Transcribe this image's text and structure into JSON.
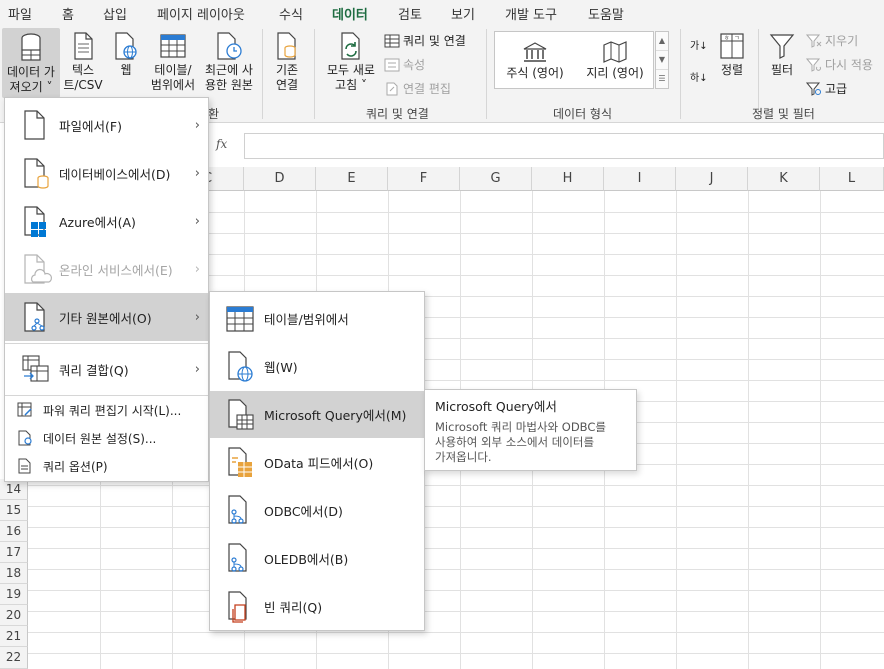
{
  "tabs": [
    "파일",
    "홈",
    "삽입",
    "페이지 레이아웃",
    "수식",
    "데이터",
    "검토",
    "보기",
    "개발 도구",
    "도움말"
  ],
  "active_tab": "데이터",
  "ribbon": {
    "get_data": {
      "line1": "데이터 가",
      "line2": "져오기 ˅"
    },
    "text_csv": {
      "line1": "텍스",
      "line2": "트/CSV"
    },
    "web": {
      "line1": "웹"
    },
    "table_range": {
      "line1": "테이블/",
      "line2": "범위에서"
    },
    "recent_sources": {
      "line1": "최근에 사",
      "line2": "용한 원본"
    },
    "existing_conn": {
      "line1": "기존",
      "line2": "연결"
    },
    "group_get_partial": "환",
    "refresh_all": {
      "line1": "모두 새로",
      "line2": "고침 ˅"
    },
    "queries_conn": "쿼리 및 연결",
    "properties": "속성",
    "edit_links": "연결 편집",
    "group_queries": "쿼리 및 연결",
    "stocks": "주식 (영어)",
    "geography": "지리 (영어)",
    "group_data_types": "데이터 형식",
    "sort_az": "가↓",
    "sort_za": "하↓",
    "sort": "정렬",
    "filter": "필터",
    "clear": "지우기",
    "reapply": "다시 적용",
    "advanced": "고급",
    "group_sort_filter": "정렬 및 필터"
  },
  "formula_bar": {
    "fx": "fx"
  },
  "columns": [
    "C",
    "D",
    "E",
    "F",
    "G",
    "H",
    "I",
    "J",
    "K",
    "L"
  ],
  "rows": [
    "14",
    "15",
    "16",
    "17",
    "18",
    "19",
    "20",
    "21",
    "22"
  ],
  "main_menu": {
    "items": [
      {
        "label": "파일에서(F)",
        "arrow": "›"
      },
      {
        "label": "데이터베이스에서(D)",
        "arrow": "›"
      },
      {
        "label": "Azure에서(A)",
        "arrow": "›"
      },
      {
        "label": "온라인 서비스에서(E)",
        "arrow": "›"
      },
      {
        "label": "기타 원본에서(O)",
        "arrow": "›"
      },
      {
        "label": "쿼리 결합(Q)",
        "arrow": "›"
      }
    ],
    "small_items": [
      {
        "label": "파워 쿼리 편집기 시작(L)..."
      },
      {
        "label": "데이터 원본 설정(S)..."
      },
      {
        "label": "쿼리 옵션(P)"
      }
    ]
  },
  "sub_menu": {
    "items": [
      {
        "label": "테이블/범위에서"
      },
      {
        "label": "웹(W)"
      },
      {
        "label": "Microsoft Query에서(M)"
      },
      {
        "label": "OData 피드에서(O)"
      },
      {
        "label": "ODBC에서(D)"
      },
      {
        "label": "OLEDB에서(B)"
      },
      {
        "label": "빈 쿼리(Q)"
      }
    ]
  },
  "tooltip": {
    "title": "Microsoft Query에서",
    "body": "Microsoft 쿼리 마법사와 ODBC를\n사용하여 외부 소스에서 데이터를\n가져옵니다."
  },
  "colors": {
    "accent": "#1e6c41",
    "azure": "#0078d4",
    "odata": "#e8a33d",
    "blank_query": "#c43e1c",
    "icon_blue": "#2b7cd3"
  }
}
